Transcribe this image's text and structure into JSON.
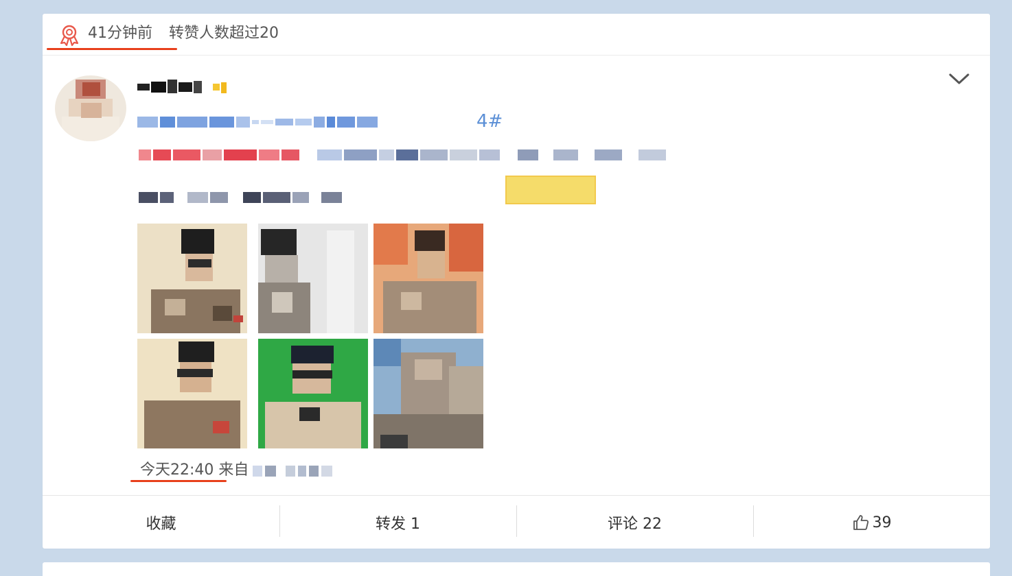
{
  "top_bar": {
    "time": "41分钟前",
    "description": "转赞人数超过20",
    "icon": "award-ribbon-icon"
  },
  "post": {
    "username_visible": "",
    "topic_tail": "4#",
    "timestamp": "今天22:40",
    "source_prefix": "来自",
    "image_count": 6
  },
  "actions": {
    "favorite": "收藏",
    "repost": "转发 1",
    "comment": "评论 22",
    "like_count": "39"
  },
  "colors": {
    "background": "#c9d9ea",
    "accent_red": "#e8401c",
    "link_blue": "#5b8fd6",
    "text_gray": "#555555"
  }
}
